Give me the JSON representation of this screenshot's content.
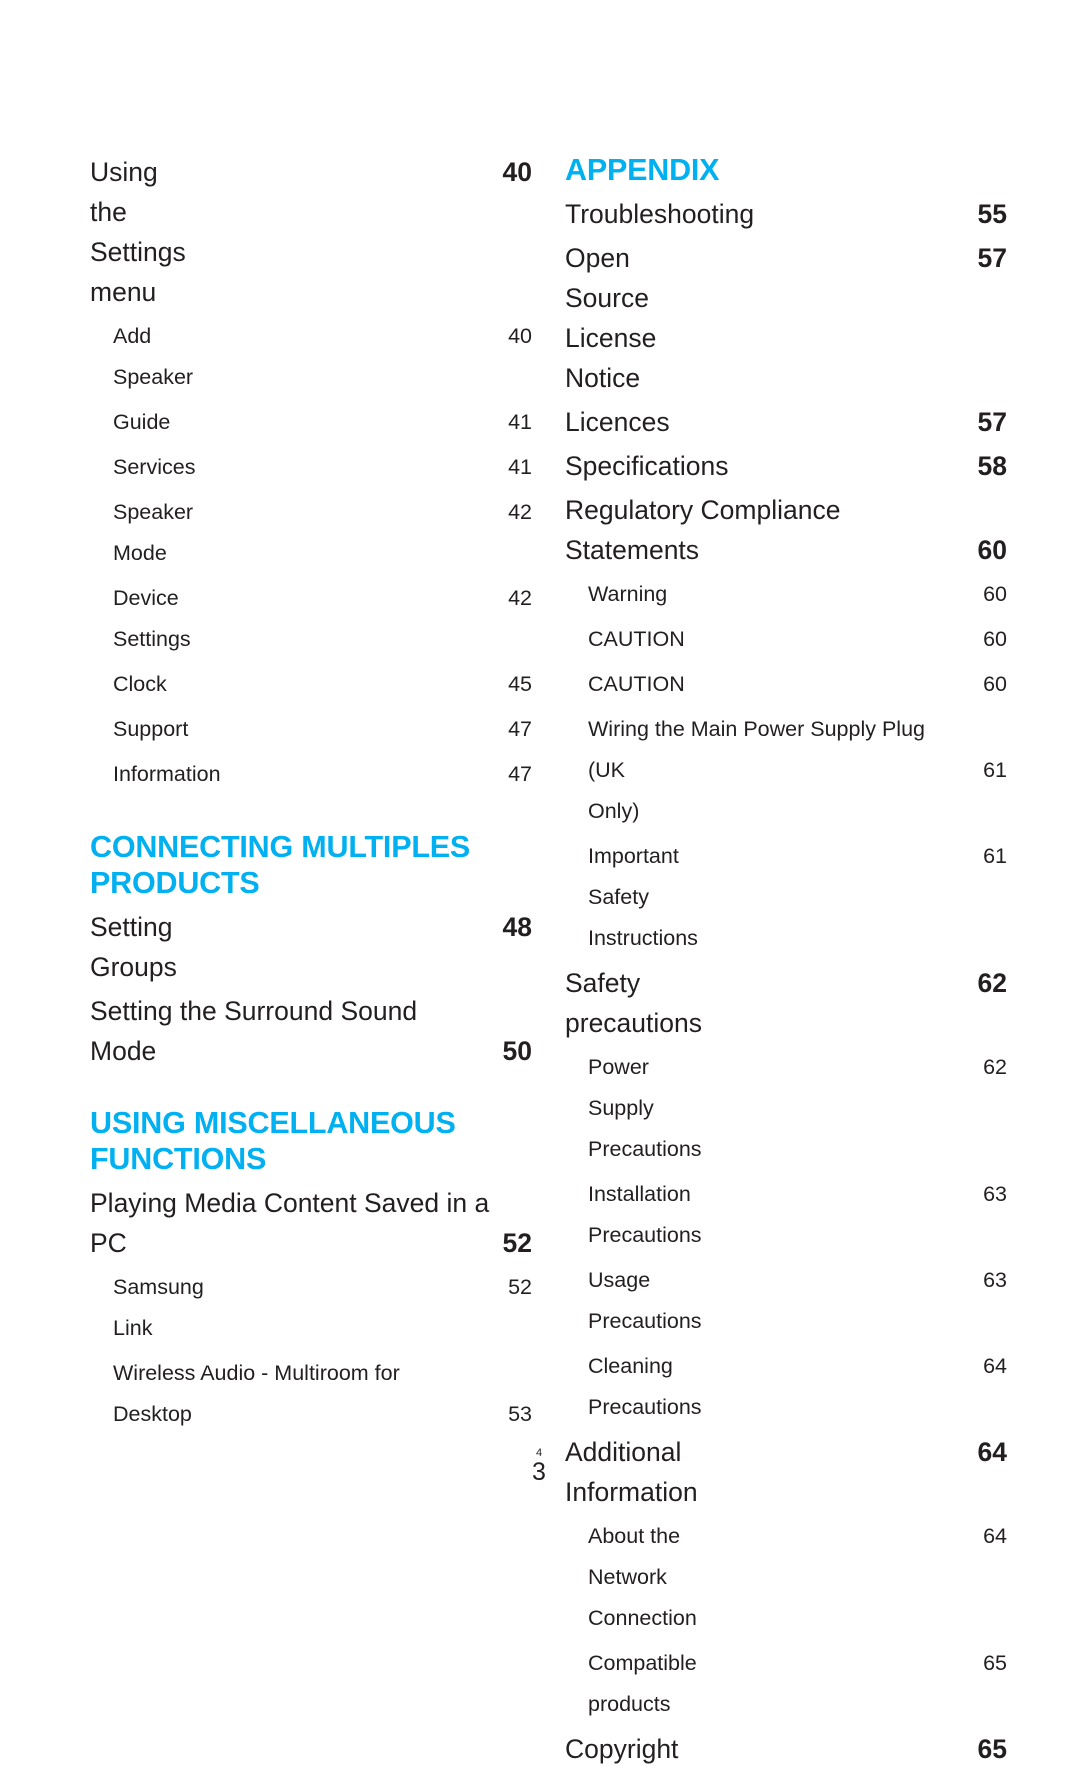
{
  "document": {
    "type": "table-of-contents",
    "folio_overlay_small": "4",
    "folio_main": "3",
    "accent_color": "#00b0f0",
    "text_color": "#231f20"
  },
  "columns": {
    "left": {
      "blocks": [
        {
          "kind": "entries",
          "entries": [
            {
              "level": 1,
              "label": "Using the Settings menu",
              "page": "40"
            },
            {
              "level": 2,
              "label": "Add Speaker",
              "page": "40"
            },
            {
              "level": 2,
              "label": "Guide",
              "page": "41"
            },
            {
              "level": 2,
              "label": "Services",
              "page": "41"
            },
            {
              "level": 2,
              "label": "Speaker Mode",
              "page": "42"
            },
            {
              "level": 2,
              "label": "Device Settings",
              "page": "42"
            },
            {
              "level": 2,
              "label": "Clock",
              "page": "45"
            },
            {
              "level": 2,
              "label": "Support",
              "page": "47"
            },
            {
              "level": 2,
              "label": "Information",
              "page": "47"
            }
          ]
        },
        {
          "kind": "heading",
          "title": "CONNECTING MULTIPLES PRODUCTS"
        },
        {
          "kind": "entries",
          "entries": [
            {
              "level": 1,
              "label": "Setting Groups",
              "page": "48"
            },
            {
              "level": 1,
              "label": "Setting the Surround Sound",
              "label2": "Mode",
              "page": "50",
              "wrapped": true
            }
          ]
        },
        {
          "kind": "heading",
          "title": "USING MISCELLANEOUS FUNCTIONS"
        },
        {
          "kind": "entries",
          "entries": [
            {
              "level": 1,
              "label": "Playing Media Content Saved in a",
              "label2": "PC",
              "page": "52",
              "wrapped": true
            },
            {
              "level": 2,
              "label": "Samsung Link",
              "page": "52"
            },
            {
              "level": 2,
              "label": "Wireless Audio - Multiroom for",
              "label2": "Desktop",
              "page": "53",
              "wrapped": true
            }
          ]
        }
      ]
    },
    "right": {
      "blocks": [
        {
          "kind": "heading",
          "title": "APPENDIX"
        },
        {
          "kind": "entries",
          "entries": [
            {
              "level": 1,
              "label": "Troubleshooting",
              "page": "55"
            },
            {
              "level": 1,
              "label": "Open Source License Notice",
              "page": "57"
            },
            {
              "level": 1,
              "label": "Licences",
              "page": "57"
            },
            {
              "level": 1,
              "label": "Specifications",
              "page": "58"
            },
            {
              "level": 1,
              "label": "Regulatory Compliance",
              "label2": "Statements",
              "page": "60",
              "wrapped": true
            },
            {
              "level": 2,
              "label": "Warning",
              "page": "60"
            },
            {
              "level": 2,
              "label": "CAUTION",
              "page": "60"
            },
            {
              "level": 2,
              "label": "CAUTION",
              "page": "60"
            },
            {
              "level": 2,
              "label": "Wiring the Main Power Supply Plug",
              "label2": "(UK Only)",
              "page": "61",
              "wrapped": true
            },
            {
              "level": 2,
              "label": "Important Safety Instructions",
              "page": "61"
            },
            {
              "level": 1,
              "label": "Safety precautions",
              "page": "62"
            },
            {
              "level": 2,
              "label": "Power Supply Precautions",
              "page": "62"
            },
            {
              "level": 2,
              "label": "Installation Precautions",
              "page": "63"
            },
            {
              "level": 2,
              "label": "Usage Precautions",
              "page": "63"
            },
            {
              "level": 2,
              "label": "Cleaning Precautions",
              "page": "64"
            },
            {
              "level": 1,
              "label": "Additional Information",
              "page": "64"
            },
            {
              "level": 2,
              "label": "About the Network Connection",
              "page": "64"
            },
            {
              "level": 2,
              "label": "Compatible products",
              "page": "65"
            },
            {
              "level": 1,
              "label": "Copyright",
              "page": "65"
            }
          ]
        }
      ]
    }
  }
}
